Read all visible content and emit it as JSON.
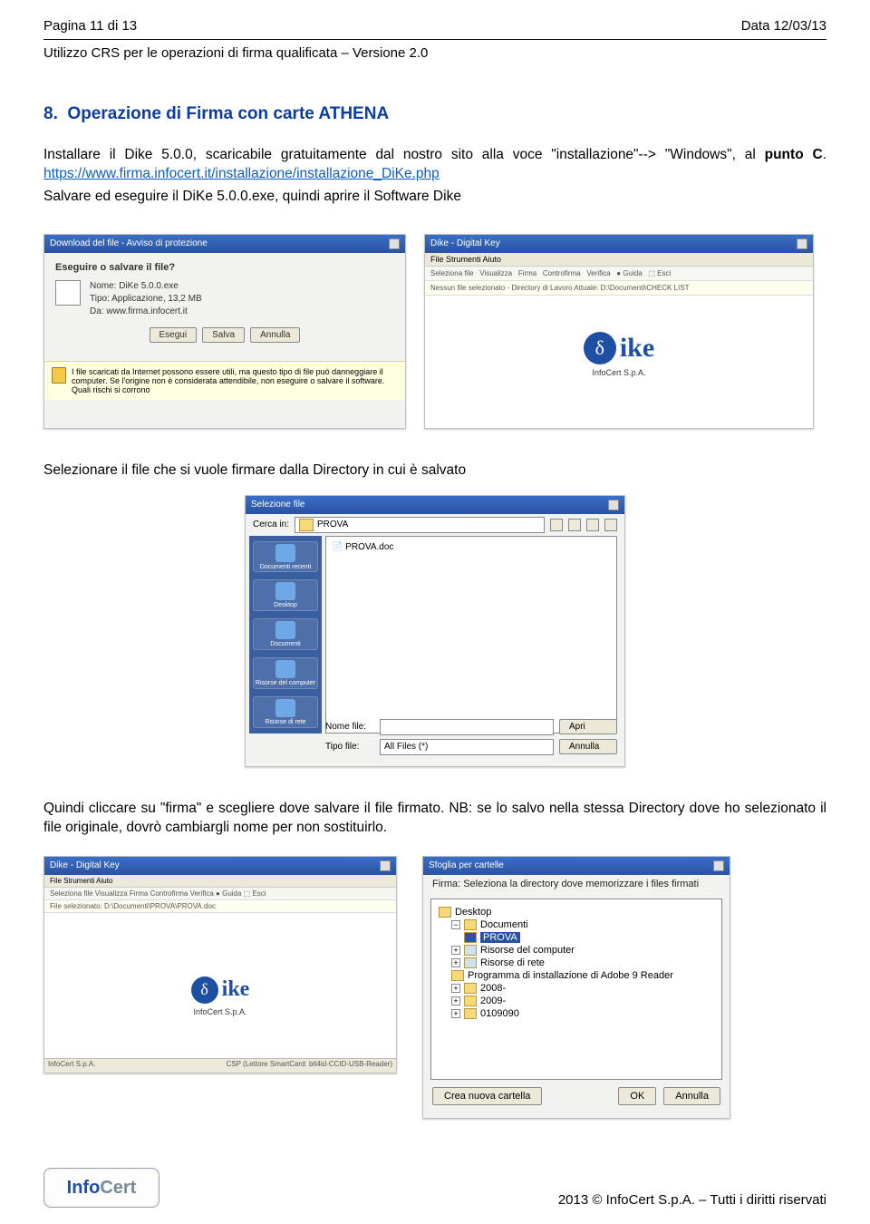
{
  "header": {
    "page_label": "Pagina 11 di 13",
    "date_label": "Data 12/03/13",
    "subheader": "Utilizzo CRS per le operazioni di firma qualificata – Versione 2.0"
  },
  "section": {
    "number": "8.",
    "title": "Operazione di Firma con carte ATHENA"
  },
  "para1": {
    "pre": "Installare il Dike 5.0.0, scaricabile gratuitamente dal nostro sito alla voce \"installazione\"--> \"Windows\", al ",
    "bold": "punto C",
    "post": ". ",
    "link": "https://www.firma.infocert.it/installazione/installazione_DiKe.php"
  },
  "para2": "Salvare ed eseguire il DiKe 5.0.0.exe, quindi aprire il Software Dike",
  "dialog_download": {
    "title": "Download del file - Avviso di protezione",
    "heading": "Eseguire o salvare il file?",
    "name_label": "Nome:",
    "name_value": "DiKe 5.0.0.exe",
    "type_label": "Tipo:",
    "type_value": "Applicazione, 13,2 MB",
    "from_label": "Da:",
    "from_value": "www.firma.infocert.it",
    "btn_run": "Esegui",
    "btn_save": "Salva",
    "btn_cancel": "Annulla",
    "warning": "I file scaricati da Internet possono essere utili, ma questo tipo di file può danneggiare il computer. Se l'origine non è considerata attendibile, non eseguire o salvare il software. Quali rischi si corrono"
  },
  "dike_window": {
    "title": "Dike - Digital Key",
    "menu": "File  Strumenti  Aiuto",
    "status1": "Nessun file selezionato - Directory di Lavoro Attuale: D:\\Documenti\\CHECK LIST",
    "brand_sub": "InfoCert S.p.A."
  },
  "para3": "Selezionare il file che si vuole firmare dalla Directory in cui è salvato",
  "file_dialog": {
    "title": "Selezione file",
    "lookin_label": "Cerca in:",
    "lookin_value": "PROVA",
    "item": "PROVA.doc",
    "side_items": [
      "Documenti recenti",
      "Desktop",
      "Documenti",
      "Risorse del computer",
      "Risorse di rete"
    ],
    "name_label": "Nome file:",
    "type_label": "Tipo file:",
    "type_value": "All Files (*)",
    "btn_open": "Apri",
    "btn_cancel": "Annulla"
  },
  "para4": "Quindi cliccare su \"firma\" e scegliere dove salvare il file firmato. NB: se lo salvo nella stessa Directory dove ho selezionato il file originale, dovrò cambiargli nome per non sostituirlo.",
  "dike_small": {
    "title": "Dike - Digital Key",
    "status": "File selezionato: D:\\Documenti\\PROVA\\PROVA.doc",
    "footer_left": "InfoCert S.p.A.",
    "footer_right": "CSP (Lettore SmartCard: bit4id-CCID-USB-Reader)"
  },
  "browse_dialog": {
    "title": "Sfoglia per cartelle",
    "caption": "Firma: Seleziona la directory dove memorizzare i files firmati",
    "nodes": {
      "desktop": "Desktop",
      "documenti": "Documenti",
      "prova": "PROVA",
      "risorse_pc": "Risorse del computer",
      "risorse_net": "Risorse di rete",
      "adobe": "Programma di installazione di Adobe 9 Reader",
      "y2008": "2008-",
      "y2009": "2009-",
      "num": "0109090"
    },
    "btn_new": "Crea nuova cartella",
    "btn_ok": "OK",
    "btn_cancel": "Annulla"
  },
  "footer": {
    "logo_a": "Info",
    "logo_b": "Cert",
    "text": "2013 © InfoCert S.p.A. – Tutti i diritti riservati"
  }
}
